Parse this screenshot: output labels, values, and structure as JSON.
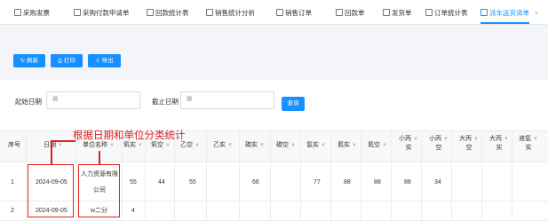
{
  "tabs": [
    {
      "label": "采购发票"
    },
    {
      "label": "采购付款申请单"
    },
    {
      "label": "回款统计表"
    },
    {
      "label": "销售统计分析"
    },
    {
      "label": "销售订单"
    },
    {
      "label": "回款单"
    },
    {
      "label": "发货单"
    },
    {
      "label": "订单统计表"
    },
    {
      "label": "派车送货清单",
      "active": true,
      "close": "×"
    }
  ],
  "toolbar": {
    "refresh_label": "刷新",
    "print_label": "打印",
    "export_label": "导出"
  },
  "filters": {
    "start_label": "起始日期",
    "end_label": "截止日期",
    "search_label": "查询"
  },
  "annotation": "根据日期和单位分类统计",
  "table": {
    "headers": [
      "序号",
      "日期",
      "单位名称",
      "氧实",
      "氧空",
      "乙空",
      "乙实",
      "碳实",
      "碳空",
      "氩实",
      "氮实",
      "氮空",
      "小丙实",
      "小丙空",
      "大丙空",
      "大丙实",
      "液氩实"
    ],
    "header_lines": {
      "col12": [
        "小丙",
        "实"
      ],
      "col13": [
        "小丙",
        "空"
      ],
      "col14": [
        "大丙",
        "空"
      ],
      "col15": [
        "大丙",
        "实"
      ],
      "col16": [
        "液氩",
        "实"
      ]
    },
    "rows": [
      {
        "seq": "1",
        "date": "2024-09-05",
        "unit_line1": "人力资源有限",
        "unit_line2": "公司",
        "cells": [
          "55",
          "44",
          "55",
          "",
          "66",
          "",
          "77",
          "88",
          "88",
          "88",
          "34",
          "",
          "",
          ""
        ]
      },
      {
        "seq": "2",
        "date": "2024-09-05",
        "unit_line1": "w二分",
        "unit_line2": "",
        "cells": [
          "4",
          "",
          "",
          "",
          "",
          "",
          "",
          "",
          "",
          "",
          "",
          "",
          "",
          ""
        ]
      }
    ]
  },
  "colors": {
    "accent": "#1890ff",
    "annotation": "#e02020"
  }
}
